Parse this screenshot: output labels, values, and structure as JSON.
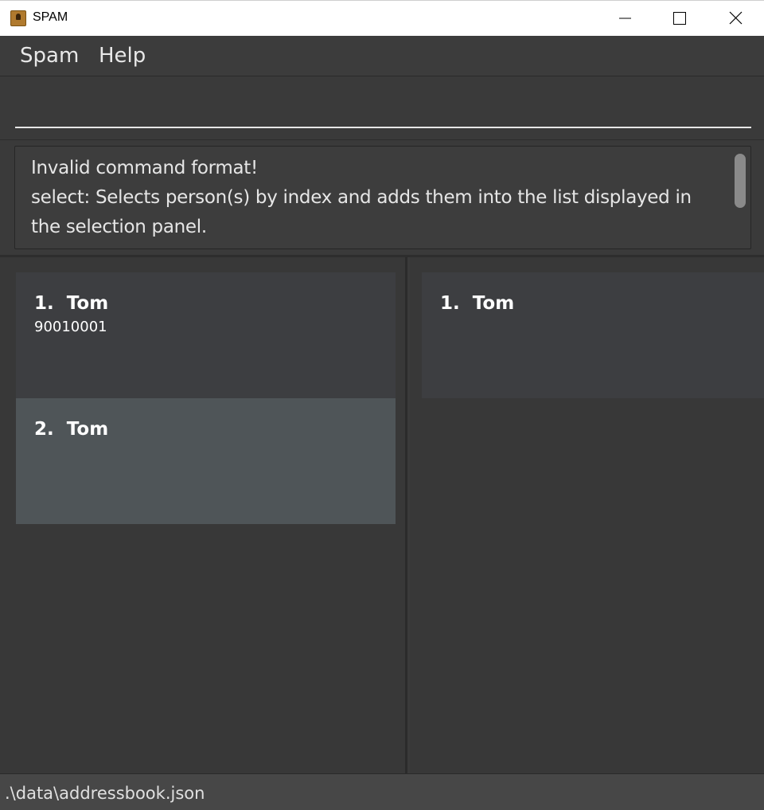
{
  "window": {
    "title": "SPAM",
    "icon": "address-book-icon"
  },
  "menu": {
    "items": [
      {
        "label": "Spam"
      },
      {
        "label": "Help"
      }
    ]
  },
  "command": {
    "value": "",
    "placeholder": ""
  },
  "result": {
    "lines": [
      "Invalid command format!",
      "select: Selects person(s) by index and adds them into the list displayed in",
      "the selection panel."
    ]
  },
  "person_list": [
    {
      "index": "1.",
      "name": "Tom",
      "phone": "90010001",
      "selected": false
    },
    {
      "index": "2.",
      "name": "Tom",
      "phone": "",
      "selected": true
    }
  ],
  "selection_list": [
    {
      "index": "1.",
      "name": "Tom"
    }
  ],
  "status": {
    "path": ".\\data\\addressbook.json"
  },
  "colors": {
    "background": "#3a3a3a",
    "card": "#3d3e41",
    "card_selected": "#4f5558",
    "text": "#ffffff"
  }
}
